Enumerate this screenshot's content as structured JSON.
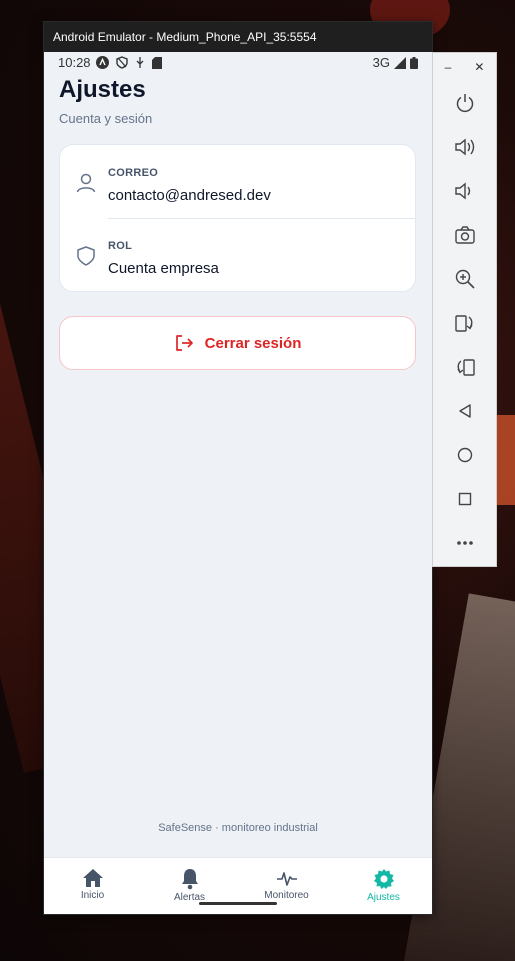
{
  "window": {
    "title": "Android Emulator - Medium_Phone_API_35:5554"
  },
  "statusbar": {
    "time": "10:28",
    "network": "3G"
  },
  "page": {
    "title": "Ajustes",
    "subtitle": "Cuenta y sesión"
  },
  "account": {
    "email_label": "CORREO",
    "email_value": "contacto@andresed.dev",
    "role_label": "ROL",
    "role_value": "Cuenta empresa"
  },
  "logout_label": "Cerrar sesión",
  "footer_note": "SafeSense · monitoreo industrial",
  "nav": {
    "items": [
      {
        "label": "Inicio",
        "icon": "home-icon"
      },
      {
        "label": "Alertas",
        "icon": "bell-icon"
      },
      {
        "label": "Monitoreo",
        "icon": "pulse-icon"
      },
      {
        "label": "Ajustes",
        "icon": "gear-icon"
      }
    ],
    "active": "Ajustes"
  },
  "colors": {
    "accent": "#14b8a6",
    "danger": "#dc2626",
    "background": "#eef1f5"
  },
  "emulator_toolbar": {
    "buttons": [
      "power-icon",
      "volume-up-icon",
      "volume-down-icon",
      "camera-icon",
      "zoom-icon",
      "rotate-left-icon",
      "rotate-right-icon",
      "back-icon",
      "home-circle-icon",
      "overview-icon",
      "more-icon"
    ]
  }
}
